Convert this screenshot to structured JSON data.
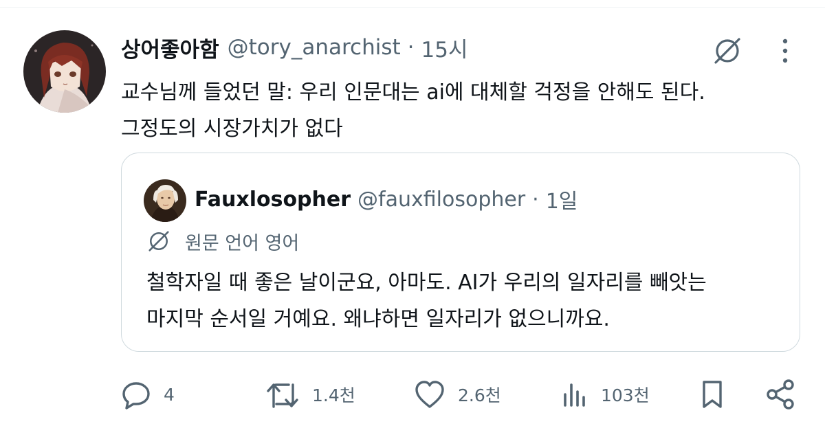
{
  "post": {
    "display_name": "상어좋아함",
    "handle": "@tory_anarchist",
    "separator": "·",
    "time": "15시",
    "text_line1": "교수님께 들었던 말: 우리 인문대는 ai에 대체할 걱정을 안해도 된다.",
    "text_line2": "그정도의 시장가치가 없다"
  },
  "quote": {
    "display_name": "Fauxlosopher",
    "handle": "@fauxfilosopher",
    "separator": "·",
    "time": "1일",
    "language_note": "원문 언어 영어",
    "text_line1": "철학자일 때 좋은 날이군요, 아마도. AI가 우리의 일자리를 빼앗는",
    "text_line2": "마지막 순서일 거예요. 왜냐하면 일자리가 없으니까요."
  },
  "actions": {
    "replies": "4",
    "reposts": "1.4천",
    "likes": "2.6천",
    "views": "103천"
  },
  "icons": {
    "translate": "translate-icon",
    "more": "more-icon",
    "reply": "reply-icon",
    "repost": "repost-icon",
    "like": "heart-icon",
    "views": "views-icon",
    "bookmark": "bookmark-icon",
    "share": "share-icon"
  },
  "colors": {
    "text_primary": "#0f1419",
    "text_secondary": "#536471",
    "border": "#cfd9de"
  }
}
